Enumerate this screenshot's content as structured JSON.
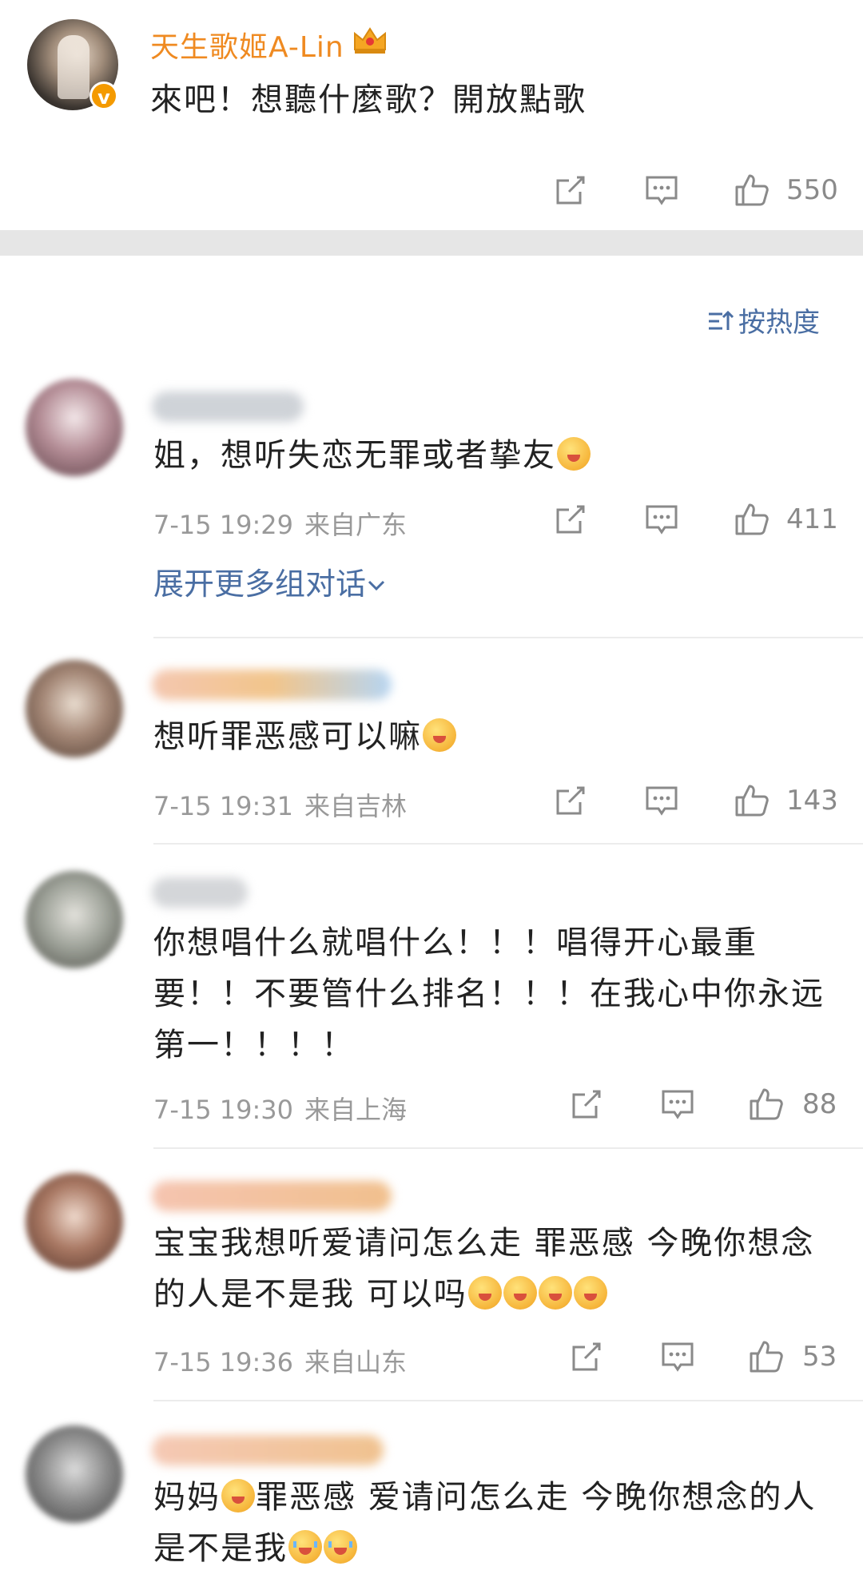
{
  "post": {
    "username": "天生歌姬A-Lin",
    "text": "來吧！想聽什麼歌？開放點歌",
    "like_count": "550",
    "verified_badge": "v"
  },
  "sort_label": "按热度",
  "expand_label": "展开更多组对话",
  "comments": [
    {
      "text": "姐，想听失恋无罪或者挚友",
      "time": "7-15 19:29",
      "location": "来自广东",
      "likes": "411"
    },
    {
      "text": "想听罪恶感可以嘛",
      "time": "7-15 19:31",
      "location": "来自吉林",
      "likes": "143"
    },
    {
      "text": "你想唱什么就唱什么！！！唱得开心最重要！！不要管什么排名！！！在我心中你永远第一！！！！",
      "time": "7-15 19:30",
      "location": "来自上海",
      "likes": "88"
    },
    {
      "text": "宝宝我想听爱请问怎么走 罪恶感 今晚你想念的人是不是我 可以吗",
      "time": "7-15 19:36",
      "location": "来自山东",
      "likes": "53"
    },
    {
      "text_a": "妈妈",
      "text_b": "罪恶感 爱请问怎么走 今晚你想念的人是不是我"
    }
  ],
  "colors": {
    "username": "#ef8a21",
    "link": "#4a6ea3",
    "meta": "#999999",
    "separator": "#e6e6e6"
  },
  "icons": [
    "crown-icon",
    "share-icon",
    "comment-icon",
    "like-icon",
    "sort-icon",
    "chevron-down-icon",
    "emoji-icon"
  ]
}
